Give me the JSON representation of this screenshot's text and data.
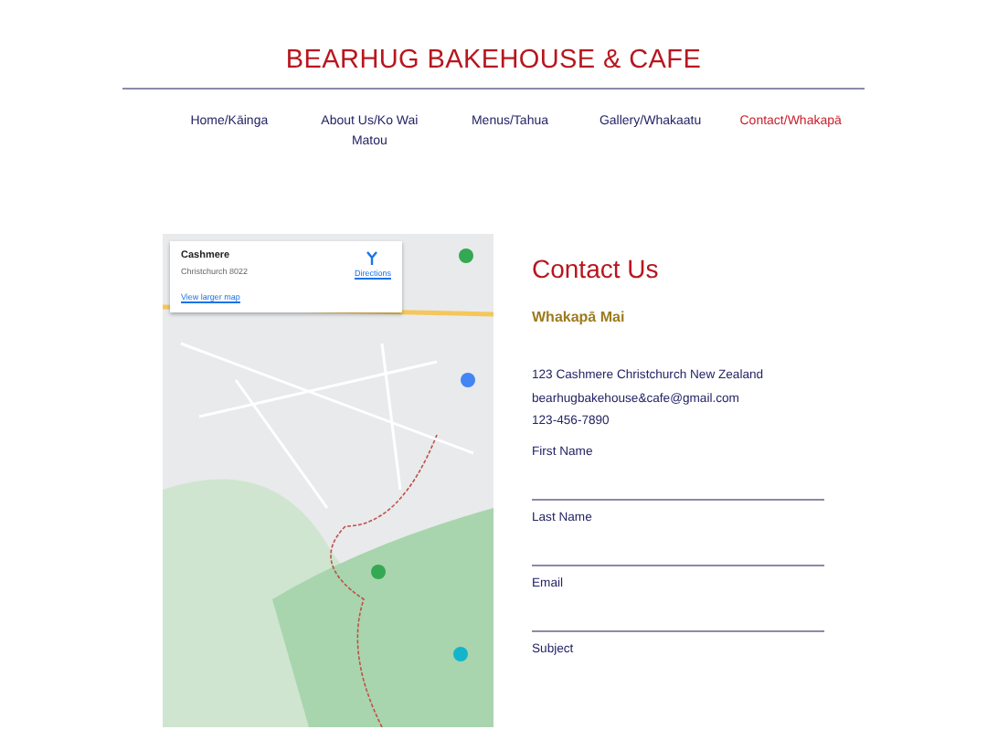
{
  "site_title": "BEARHUG BAKEHOUSE & CAFE",
  "nav": [
    {
      "label": "Home/Kāinga",
      "selected": false
    },
    {
      "label": "About Us/Ko Wai Matou",
      "selected": false
    },
    {
      "label": "Menus/Tahua",
      "selected": false
    },
    {
      "label": "Gallery/Whakaatu",
      "selected": false
    },
    {
      "label": "Contact/Whakapā",
      "selected": true
    }
  ],
  "map_card": {
    "place": "Cashmere",
    "address": "Christchurch 8022",
    "directions": "Directions",
    "larger_map": "View larger map"
  },
  "contact": {
    "heading": "Contact Us",
    "subheading": "Whakapā Mai",
    "lines": [
      "123 Cashmere Christchurch New Zealand",
      "bearhugbakehouse&cafe@gmail.com",
      "123-456-7890"
    ],
    "fields": [
      {
        "label": "First Name"
      },
      {
        "label": "Last Name"
      },
      {
        "label": "Email"
      },
      {
        "label": "Subject"
      }
    ]
  }
}
